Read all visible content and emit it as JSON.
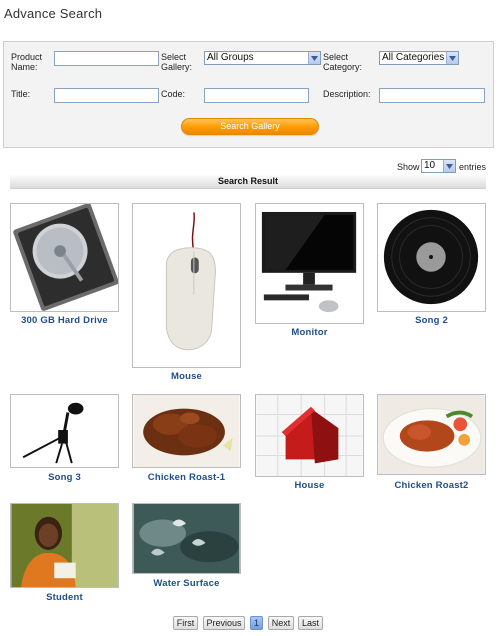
{
  "page": {
    "title": "Advance Search"
  },
  "form": {
    "product_name_label": "Product Name:",
    "select_gallery_label": "Select Gallery:",
    "gallery_value": "All Groups",
    "select_category_label": "Select Category:",
    "category_value": "All Categories",
    "title_label": "Title:",
    "code_label": "Code:",
    "description_label": "Description:",
    "search_button": "Search Gallery"
  },
  "listing": {
    "show_label": "Show",
    "page_size": "10",
    "entries_label": "entries",
    "result_header": "Search Result"
  },
  "items": [
    {
      "caption": "300 GB Hard Drive",
      "icon": "hard-drive-image"
    },
    {
      "caption": "Mouse",
      "icon": "mouse-image"
    },
    {
      "caption": "Monitor",
      "icon": "monitor-image"
    },
    {
      "caption": "Song 2",
      "icon": "vinyl-record-image"
    },
    {
      "caption": "Song 3",
      "icon": "microphone-image"
    },
    {
      "caption": "Chicken Roast-1",
      "icon": "chicken-roast-image"
    },
    {
      "caption": "House",
      "icon": "puzzle-house-image"
    },
    {
      "caption": "Chicken Roast2",
      "icon": "chicken-plate-image"
    },
    {
      "caption": "Student",
      "icon": "student-image"
    },
    {
      "caption": "Water Surface",
      "icon": "water-surface-image"
    }
  ],
  "pager": {
    "first": "First",
    "previous": "Previous",
    "current": "1",
    "next": "Next",
    "last": "Last"
  },
  "colors": {
    "caption": "#1f4e8c",
    "button_orange": "#ff9a00",
    "panel_bg": "#f3f3f3"
  }
}
